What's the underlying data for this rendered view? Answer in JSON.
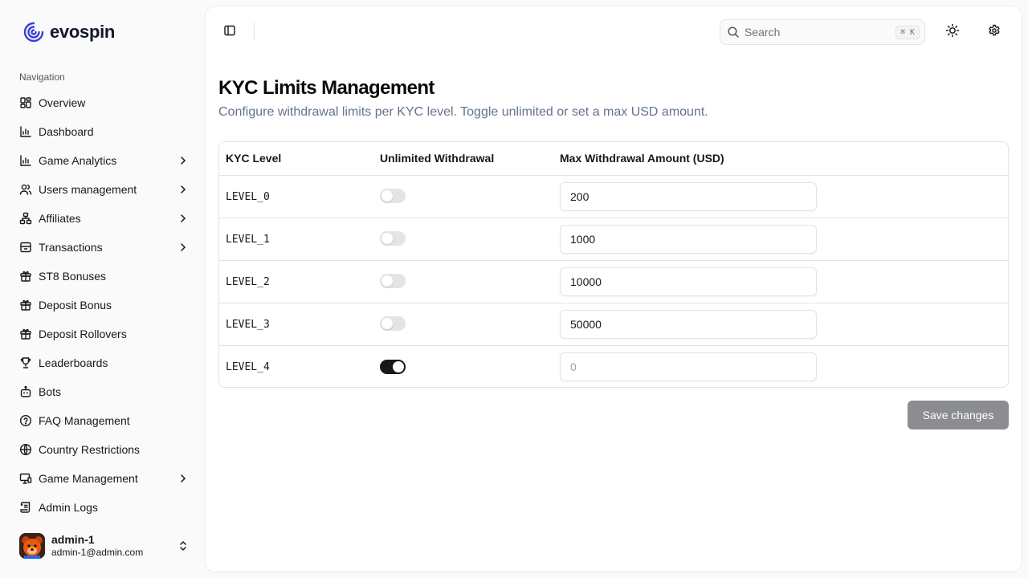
{
  "brand": {
    "name": "evospin"
  },
  "sidebar": {
    "heading": "Navigation",
    "items": [
      {
        "label": "Overview",
        "icon": "grid-icon",
        "chevron": false
      },
      {
        "label": "Dashboard",
        "icon": "bar-chart-icon",
        "chevron": false
      },
      {
        "label": "Game Analytics",
        "icon": "bar-chart-icon",
        "chevron": true
      },
      {
        "label": "Users management",
        "icon": "users-icon",
        "chevron": true
      },
      {
        "label": "Affiliates",
        "icon": "network-icon",
        "chevron": true
      },
      {
        "label": "Transactions",
        "icon": "archive-icon",
        "chevron": true
      },
      {
        "label": "ST8 Bonuses",
        "icon": "gift-icon",
        "chevron": false
      },
      {
        "label": "Deposit Bonus",
        "icon": "gift-icon",
        "chevron": false
      },
      {
        "label": "Deposit Rollovers",
        "icon": "gift-icon",
        "chevron": false
      },
      {
        "label": "Leaderboards",
        "icon": "trophy-icon",
        "chevron": false
      },
      {
        "label": "Bots",
        "icon": "bot-icon",
        "chevron": false
      },
      {
        "label": "FAQ Management",
        "icon": "help-circle-icon",
        "chevron": false
      },
      {
        "label": "Country Restrictions",
        "icon": "globe-icon",
        "chevron": false
      },
      {
        "label": "Game Management",
        "icon": "monitor-icon",
        "chevron": true
      },
      {
        "label": "Admin Logs",
        "icon": "scroll-icon",
        "chevron": false
      }
    ]
  },
  "user": {
    "name": "admin-1",
    "email": "admin-1@admin.com"
  },
  "header": {
    "search_placeholder": "Search",
    "shortcut": "⌘ K"
  },
  "page": {
    "title": "KYC Limits Management",
    "subtitle": "Configure withdrawal limits per KYC level. Toggle unlimited or set a max USD amount."
  },
  "table": {
    "headers": [
      "KYC Level",
      "Unlimited Withdrawal",
      "Max Withdrawal Amount (USD)"
    ],
    "rows": [
      {
        "level": "LEVEL_0",
        "unlimited": false,
        "amount": "200"
      },
      {
        "level": "LEVEL_1",
        "unlimited": false,
        "amount": "1000"
      },
      {
        "level": "LEVEL_2",
        "unlimited": false,
        "amount": "10000"
      },
      {
        "level": "LEVEL_3",
        "unlimited": false,
        "amount": "50000"
      },
      {
        "level": "LEVEL_4",
        "unlimited": true,
        "amount": "",
        "placeholder": "0"
      }
    ]
  },
  "actions": {
    "save_label": "Save changes"
  },
  "colors": {
    "accent": "#18181b",
    "muted_text": "#64748b",
    "brand": "#3b3fd8",
    "save_disabled": "#8b8d93"
  }
}
